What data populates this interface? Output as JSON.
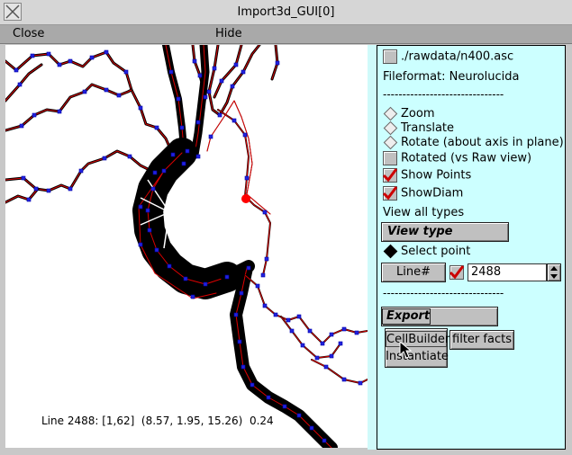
{
  "window": {
    "title": "Import3d_GUI[0]"
  },
  "menu": {
    "close": "Close",
    "hide": "Hide"
  },
  "status_line": "Line 2488: [1,62]  (8.57, 1.95, 15.26)  0.24",
  "panel": {
    "file_label": "./rawdata/n400.asc",
    "file_format": "Fileformat: Neurolucida",
    "separator1": "-------------------------------",
    "zoom": "Zoom",
    "translate": "Translate",
    "rotate": "Rotate (about axis in plane)",
    "rotated": "Rotated (vs Raw view)",
    "show_points": "Show Points",
    "show_diam": "ShowDiam",
    "view_all": "View all types",
    "view_type": "View type",
    "select_point": "Select point",
    "line_button": "Line#",
    "line_value": "2488",
    "separator2": "-------------------------------",
    "export": "Export",
    "cellbuilder": "CellBuilder",
    "instantiate": "Instantiate",
    "filter_facts": "filter facts"
  },
  "state": {
    "show_points": true,
    "show_diam": true,
    "rotated": false,
    "line_enabled": true,
    "select_point": true
  },
  "colors": {
    "panel_bg": "#ccffff",
    "trace": "#000000",
    "axis": "#dd0000",
    "points": "#2222dd",
    "selected": "#ff0000"
  }
}
